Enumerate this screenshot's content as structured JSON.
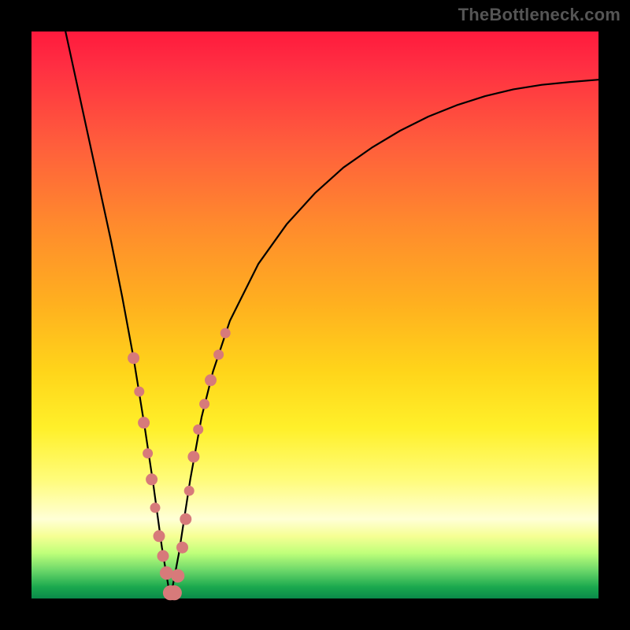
{
  "watermark": "TheBottleneck.com",
  "colors": {
    "background": "#000000",
    "gradient_top": "#ff1a3d",
    "gradient_bottom": "#0a8a4a",
    "curve": "#000000",
    "beads": "#d77a7a"
  },
  "chart_data": {
    "type": "line",
    "title": "",
    "xlabel": "",
    "ylabel": "",
    "xlim": [
      0,
      1
    ],
    "ylim": [
      0,
      1
    ],
    "note": "V-shaped bottleneck curve over a red-to-green heat gradient. Curve minimum near x≈0.245 at y≈0. Salmon beads mark sampled points on both branches.",
    "series": [
      {
        "name": "bottleneck-curve",
        "x_norm": [
          0.06,
          0.08,
          0.1,
          0.12,
          0.14,
          0.16,
          0.18,
          0.2,
          0.215,
          0.23,
          0.245,
          0.26,
          0.28,
          0.3,
          0.32,
          0.35,
          0.4,
          0.45,
          0.5,
          0.55,
          0.6,
          0.65,
          0.7,
          0.75,
          0.8,
          0.85,
          0.9,
          0.95,
          1.0
        ],
        "y_norm": [
          1.0,
          0.908,
          0.816,
          0.724,
          0.632,
          0.532,
          0.424,
          0.3,
          0.2,
          0.09,
          0.0,
          0.08,
          0.21,
          0.32,
          0.4,
          0.49,
          0.59,
          0.66,
          0.715,
          0.76,
          0.795,
          0.825,
          0.85,
          0.87,
          0.886,
          0.898,
          0.906,
          0.911,
          0.915
        ]
      }
    ],
    "beads_norm": [
      {
        "x": 0.18,
        "y": 0.424,
        "r": 7
      },
      {
        "x": 0.19,
        "y": 0.365,
        "r": 6
      },
      {
        "x": 0.198,
        "y": 0.31,
        "r": 7
      },
      {
        "x": 0.205,
        "y": 0.256,
        "r": 6
      },
      {
        "x": 0.212,
        "y": 0.21,
        "r": 7
      },
      {
        "x": 0.218,
        "y": 0.16,
        "r": 6
      },
      {
        "x": 0.225,
        "y": 0.11,
        "r": 7
      },
      {
        "x": 0.232,
        "y": 0.075,
        "r": 7
      },
      {
        "x": 0.238,
        "y": 0.045,
        "r": 8
      },
      {
        "x": 0.245,
        "y": 0.01,
        "r": 9
      },
      {
        "x": 0.252,
        "y": 0.01,
        "r": 9
      },
      {
        "x": 0.258,
        "y": 0.04,
        "r": 8
      },
      {
        "x": 0.266,
        "y": 0.09,
        "r": 7
      },
      {
        "x": 0.272,
        "y": 0.14,
        "r": 7
      },
      {
        "x": 0.278,
        "y": 0.19,
        "r": 6
      },
      {
        "x": 0.286,
        "y": 0.25,
        "r": 7
      },
      {
        "x": 0.294,
        "y": 0.298,
        "r": 6
      },
      {
        "x": 0.305,
        "y": 0.343,
        "r": 6
      },
      {
        "x": 0.316,
        "y": 0.385,
        "r": 7
      },
      {
        "x": 0.33,
        "y": 0.43,
        "r": 6
      },
      {
        "x": 0.342,
        "y": 0.468,
        "r": 6
      }
    ]
  }
}
